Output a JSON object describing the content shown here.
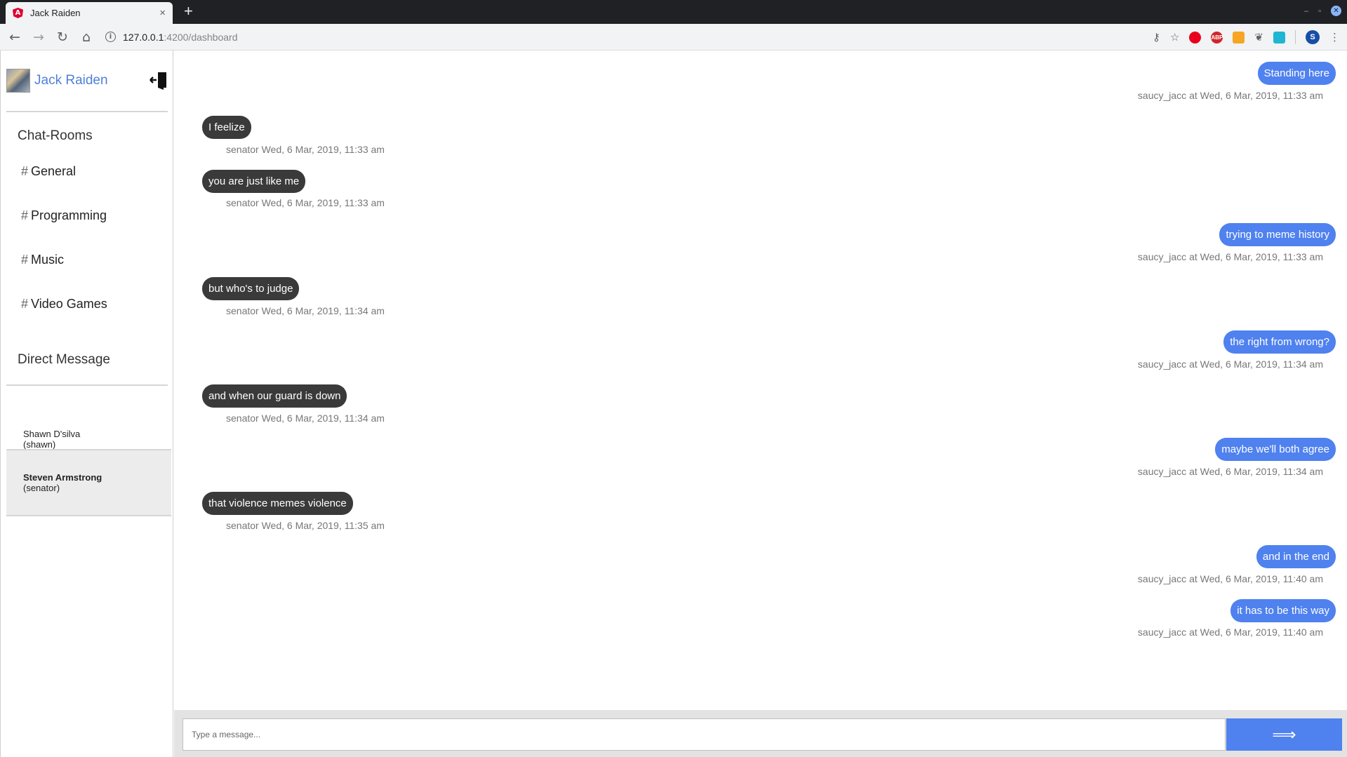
{
  "browser": {
    "tab_title": "Jack Raiden",
    "tab_close": "×",
    "new_tab": "+",
    "url_host": "127.0.0.1",
    "url_path": ":4200/dashboard",
    "window_controls": {
      "minimize": "–",
      "restore": "▫",
      "close": "✕"
    },
    "extensions": [
      {
        "name": "key-icon",
        "glyph": "⚷"
      },
      {
        "name": "star-icon",
        "glyph": "☆"
      },
      {
        "name": "opera-extension-icon",
        "glyph": "",
        "color": "#e8001c"
      },
      {
        "name": "adblock-icon",
        "glyph": "ABP",
        "color": "#d0262c"
      },
      {
        "name": "colorpick-extension-icon",
        "glyph": "",
        "color": "#f6a623"
      },
      {
        "name": "extension-icon",
        "glyph": "❦"
      },
      {
        "name": "translate-extension-icon",
        "glyph": "",
        "color": "#1fb6d4"
      }
    ],
    "profile_initial": "S"
  },
  "user": {
    "name": "Jack Raiden"
  },
  "sidebar": {
    "rooms_title": "Chat-Rooms",
    "rooms": [
      {
        "hash": "#",
        "label": "General"
      },
      {
        "hash": "#",
        "label": "Programming"
      },
      {
        "hash": "#",
        "label": "Music"
      },
      {
        "hash": "#",
        "label": "Video Games"
      }
    ],
    "dm_title": "Direct Message",
    "dms": [
      {
        "name": "Shawn D'silva",
        "handle": "(shawn)",
        "active": false
      },
      {
        "name": "Steven Armstrong",
        "handle": "(senator)",
        "active": true
      }
    ]
  },
  "messages": [
    {
      "direction": "out",
      "text": "Standing here",
      "meta": "saucy_jacc at Wed, 6 Mar, 2019, 11:33 am"
    },
    {
      "direction": "in",
      "text": "I feelize",
      "meta": "senator Wed, 6 Mar, 2019, 11:33 am"
    },
    {
      "direction": "in",
      "text": "you are just like me",
      "meta": "senator Wed, 6 Mar, 2019, 11:33 am"
    },
    {
      "direction": "out",
      "text": "trying to meme history",
      "meta": "saucy_jacc at Wed, 6 Mar, 2019, 11:33 am"
    },
    {
      "direction": "in",
      "text": "but who's to judge",
      "meta": "senator Wed, 6 Mar, 2019, 11:34 am"
    },
    {
      "direction": "out",
      "text": "the right from wrong?",
      "meta": "saucy_jacc at Wed, 6 Mar, 2019, 11:34 am"
    },
    {
      "direction": "in",
      "text": "and when our guard is down",
      "meta": "senator Wed, 6 Mar, 2019, 11:34 am"
    },
    {
      "direction": "out",
      "text": "maybe we'll both agree",
      "meta": "saucy_jacc at Wed, 6 Mar, 2019, 11:34 am"
    },
    {
      "direction": "in",
      "text": "that violence memes violence",
      "meta": "senator Wed, 6 Mar, 2019, 11:35 am"
    },
    {
      "direction": "out",
      "text": "and in the end",
      "meta": "saucy_jacc at Wed, 6 Mar, 2019, 11:40 am"
    },
    {
      "direction": "out",
      "text": "it has to be this way",
      "meta": "saucy_jacc at Wed, 6 Mar, 2019, 11:40 am"
    }
  ],
  "composer": {
    "placeholder": "Type a message...",
    "value": "",
    "send_label": "⟹"
  },
  "colors": {
    "accent": "#4f81ef",
    "incoming_bubble": "#3a3a3a",
    "username": "#4f81d6"
  }
}
